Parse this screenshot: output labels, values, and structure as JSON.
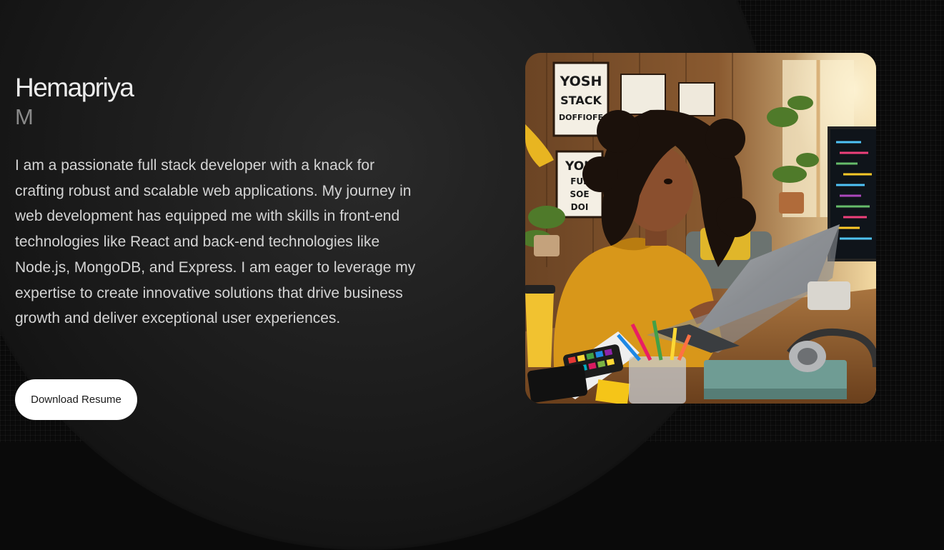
{
  "hero": {
    "first_name": "Hemapriya",
    "last_name": "M",
    "bio": "I am a passionate full stack developer with a knack for crafting robust and scalable web applications. My journey in web development has equipped me with skills in front-end technologies like React and back-end technologies like Node.js, MongoDB, and Express. I am eager to leverage my expertise to create innovative solutions that drive business growth and deliver exceptional user experiences.",
    "resume_button": "Download Resume"
  },
  "photo": {
    "poster_1": [
      "YOSH",
      "STACK",
      "DOFFIOFE"
    ],
    "poster_2": [
      "YOU",
      "FUL",
      "SOE",
      "DOI"
    ]
  }
}
